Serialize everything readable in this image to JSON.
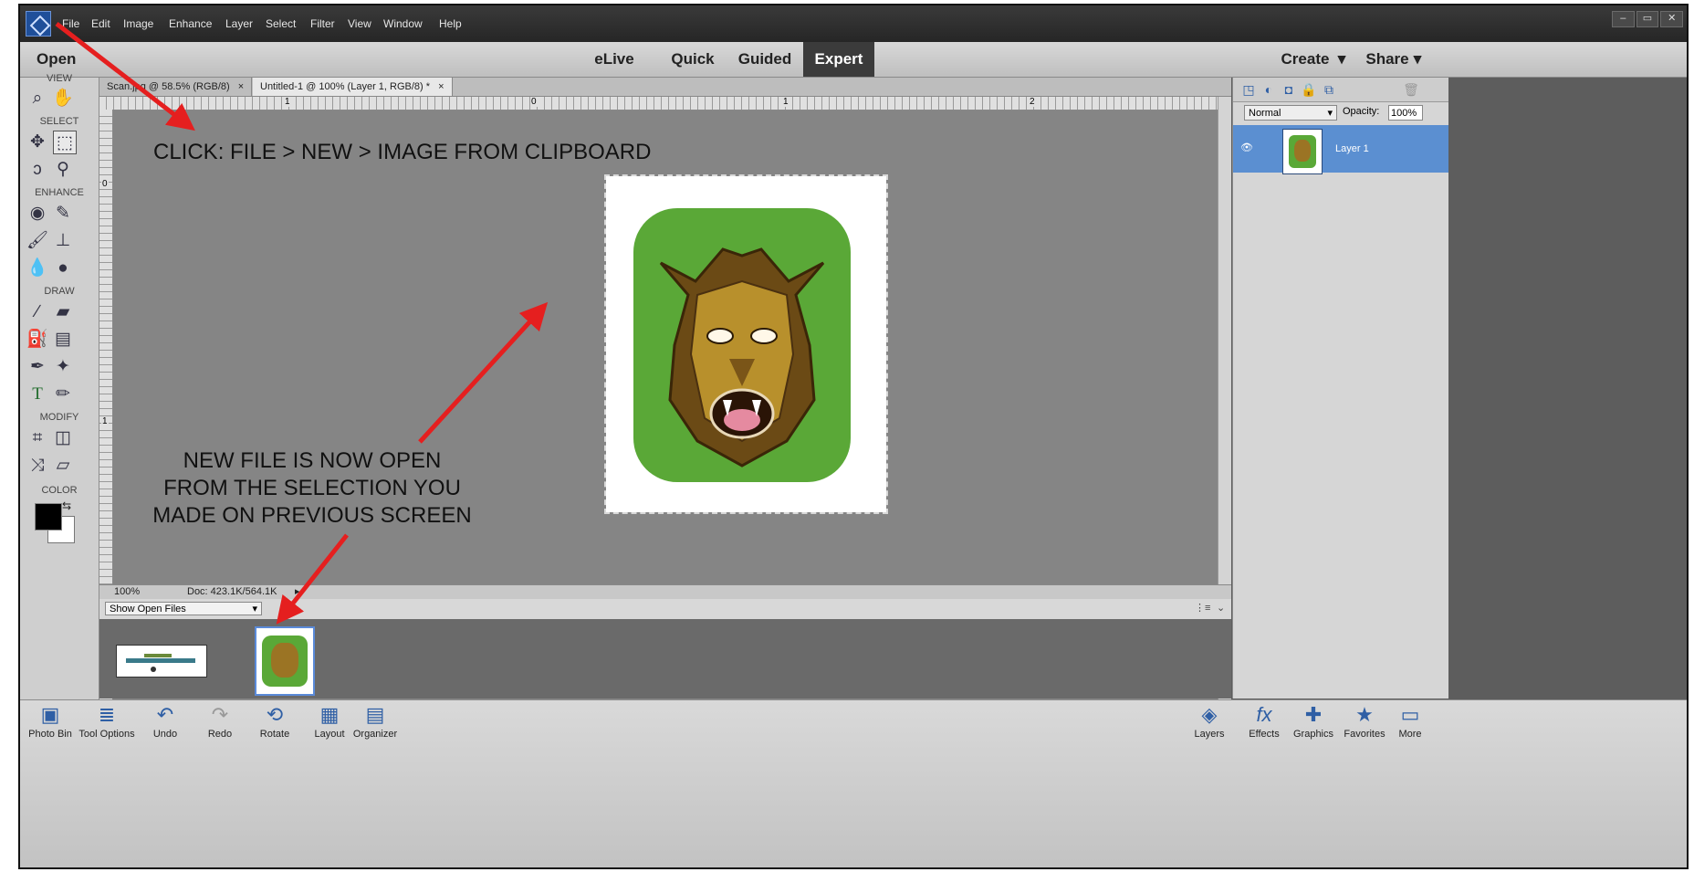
{
  "menubar": {
    "items": [
      "File",
      "Edit",
      "Image",
      "Enhance",
      "Layer",
      "Select",
      "Filter",
      "View",
      "Window",
      "Help"
    ],
    "window_controls": [
      "–",
      "▭",
      "✕"
    ]
  },
  "modebar": {
    "open_label": "Open",
    "modes": [
      "eLive",
      "Quick",
      "Guided",
      "Expert"
    ],
    "active_mode": "Expert",
    "create_label": "Create",
    "share_label": "Share"
  },
  "toolpanel": {
    "sections": [
      "VIEW",
      "SELECT",
      "ENHANCE",
      "DRAW",
      "MODIFY",
      "COLOR"
    ],
    "foreground_color": "#000000",
    "background_color": "#ffffff"
  },
  "doc_tabs": [
    {
      "label": "Scan.jpg @ 58.5% (RGB/8)",
      "close": "×"
    },
    {
      "label": "Untitled-1 @ 100% (Layer 1, RGB/8) *",
      "close": "×"
    }
  ],
  "rulers": {
    "top": [
      "1",
      "0",
      "1",
      "2"
    ],
    "left": [
      "0",
      "1"
    ]
  },
  "status": {
    "zoom": "100%",
    "doc_size": "Doc: 423.1K/564.1K"
  },
  "photo_bin": {
    "dropdown": "Show Open Files"
  },
  "bottombar": {
    "tools": [
      "Photo Bin",
      "Tool Options",
      "Undo",
      "Redo",
      "Rotate",
      "Layout",
      "Organizer"
    ],
    "right_tools": [
      "Layers",
      "Effects",
      "Graphics",
      "Favorites",
      "More"
    ]
  },
  "layers_panel": {
    "blend_mode": "Normal",
    "opacity_label": "Opacity:",
    "opacity_value": "100%",
    "layer_name": "Layer 1"
  },
  "annotations": {
    "click_instruction": "CLICK: FILE > NEW > IMAGE FROM CLIPBOARD",
    "new_file_note_line1": "NEW FILE IS NOW OPEN",
    "new_file_note_line2": "FROM THE SELECTION YOU",
    "new_file_note_line3": "MADE ON PREVIOUS SCREEN",
    "arrow_color": "#e51f1f"
  },
  "colors": {
    "accent": "#5b8fd1",
    "tile_green": "#5aa837",
    "canvas_gray": "#858585"
  }
}
